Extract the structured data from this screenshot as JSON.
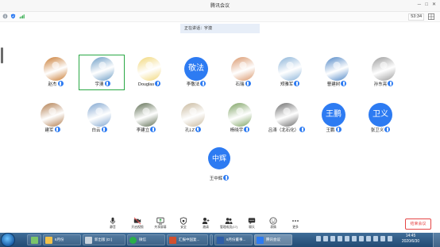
{
  "window": {
    "title": "腾讯会议"
  },
  "info_bar": {
    "timer": "53:34"
  },
  "speaking_banner": "正在讲话：宇澳",
  "participants_row1": [
    {
      "name": "赵杰",
      "avatar": "photo",
      "color": "#c9792f"
    },
    {
      "name": "宇澳",
      "avatar": "photo",
      "color": "#6a9bc5",
      "selected": true
    },
    {
      "name": "Douglas",
      "avatar": "photo",
      "color": "#f1d778"
    },
    {
      "name": "李敬法",
      "avatar": "text",
      "avatar_text": "敬法"
    },
    {
      "name": "石瑞",
      "avatar": "photo",
      "color": "#d99569"
    },
    {
      "name": "郑雅军",
      "avatar": "photo",
      "color": "#8ab3d8"
    },
    {
      "name": "曹建树",
      "avatar": "photo",
      "color": "#4f86c6"
    },
    {
      "name": "孙东亮",
      "avatar": "photo",
      "color": "#9a9a9a"
    }
  ],
  "participants_row2": [
    {
      "name": "建军",
      "avatar": "photo",
      "color": "#b07a4a"
    },
    {
      "name": "白云",
      "avatar": "photo",
      "color": "#7ea4cf"
    },
    {
      "name": "李建立",
      "avatar": "photo",
      "color": "#5b6b4f"
    },
    {
      "name": "孔LZ",
      "avatar": "photo",
      "color": "#c8b89c"
    },
    {
      "name": "杨晓宇",
      "avatar": "photo",
      "color": "#7aa05e"
    },
    {
      "name": "吕涛（北石化）",
      "avatar": "photo",
      "color": "#6a6a6a"
    },
    {
      "name": "王鹏",
      "avatar": "text",
      "avatar_text": "王鹏"
    },
    {
      "name": "张卫义",
      "avatar": "text",
      "avatar_text": "卫义"
    }
  ],
  "participants_row3": [
    {
      "name": "王中辉",
      "avatar": "text",
      "avatar_text": "中辉"
    }
  ],
  "toolbar": {
    "items": [
      {
        "label": "静音",
        "icon": "microphone-icon"
      },
      {
        "label": "开启视频",
        "icon": "video-off-icon"
      },
      {
        "label": "共享屏幕",
        "icon": "share-screen-icon"
      },
      {
        "label": "安全",
        "icon": "shield-icon"
      },
      {
        "label": "邀请",
        "icon": "invite-icon"
      },
      {
        "label": "管理成员(17)",
        "icon": "members-icon"
      },
      {
        "label": "聊天",
        "icon": "chat-icon"
      },
      {
        "label": "表情",
        "icon": "emoji-icon"
      },
      {
        "label": "更多",
        "icon": "more-icon"
      }
    ],
    "end_label": "结束会议"
  },
  "taskbar": {
    "tasks": [
      {
        "label": "",
        "icon": "app-icon"
      },
      {
        "label": "6月份",
        "icon": "folder-icon"
      },
      {
        "label": "新出版 (D:)",
        "icon": "drive-icon"
      },
      {
        "label": "微信",
        "icon": "wechat-icon"
      },
      {
        "label": "汇报中国复...",
        "icon": "powerpoint-icon"
      },
      {
        "label": "",
        "icon": "app-icon"
      },
      {
        "label": "6月份董事...",
        "icon": "word-icon"
      },
      {
        "label": "腾讯会议",
        "icon": "tencent-meeting-icon"
      }
    ],
    "time": "14:45",
    "date": "2020/6/30"
  },
  "colors": {
    "accent": "#2d7bf2",
    "end": "#e54545",
    "taskbar": "#2a5580"
  }
}
